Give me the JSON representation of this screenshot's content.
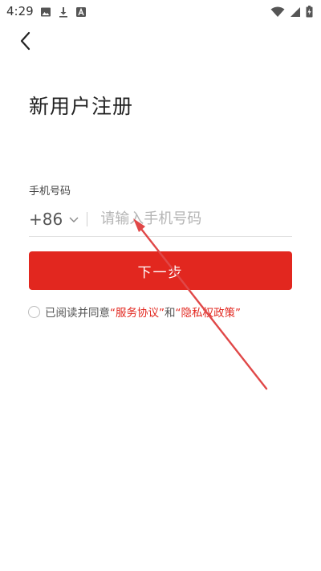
{
  "status_bar": {
    "time": "4:29",
    "left_icons": [
      "image-icon",
      "download-icon",
      "font-a-icon"
    ],
    "right_icons": [
      "wifi-icon",
      "signal-icon",
      "battery-charging-icon"
    ]
  },
  "header": {
    "back_icon": "chevron-left-icon"
  },
  "title": "新用户注册",
  "phone": {
    "label": "手机号码",
    "country_code": "+86",
    "value": "",
    "placeholder": "请输入手机号码"
  },
  "next_button": {
    "label": "下一步"
  },
  "agreement": {
    "prefix": "已阅读并同意",
    "terms": "“服务协议”",
    "conjunction": "和",
    "privacy": "“隐私权政策”",
    "checked": false
  },
  "colors": {
    "accent": "#e2271f",
    "annotation": "#e04848"
  }
}
